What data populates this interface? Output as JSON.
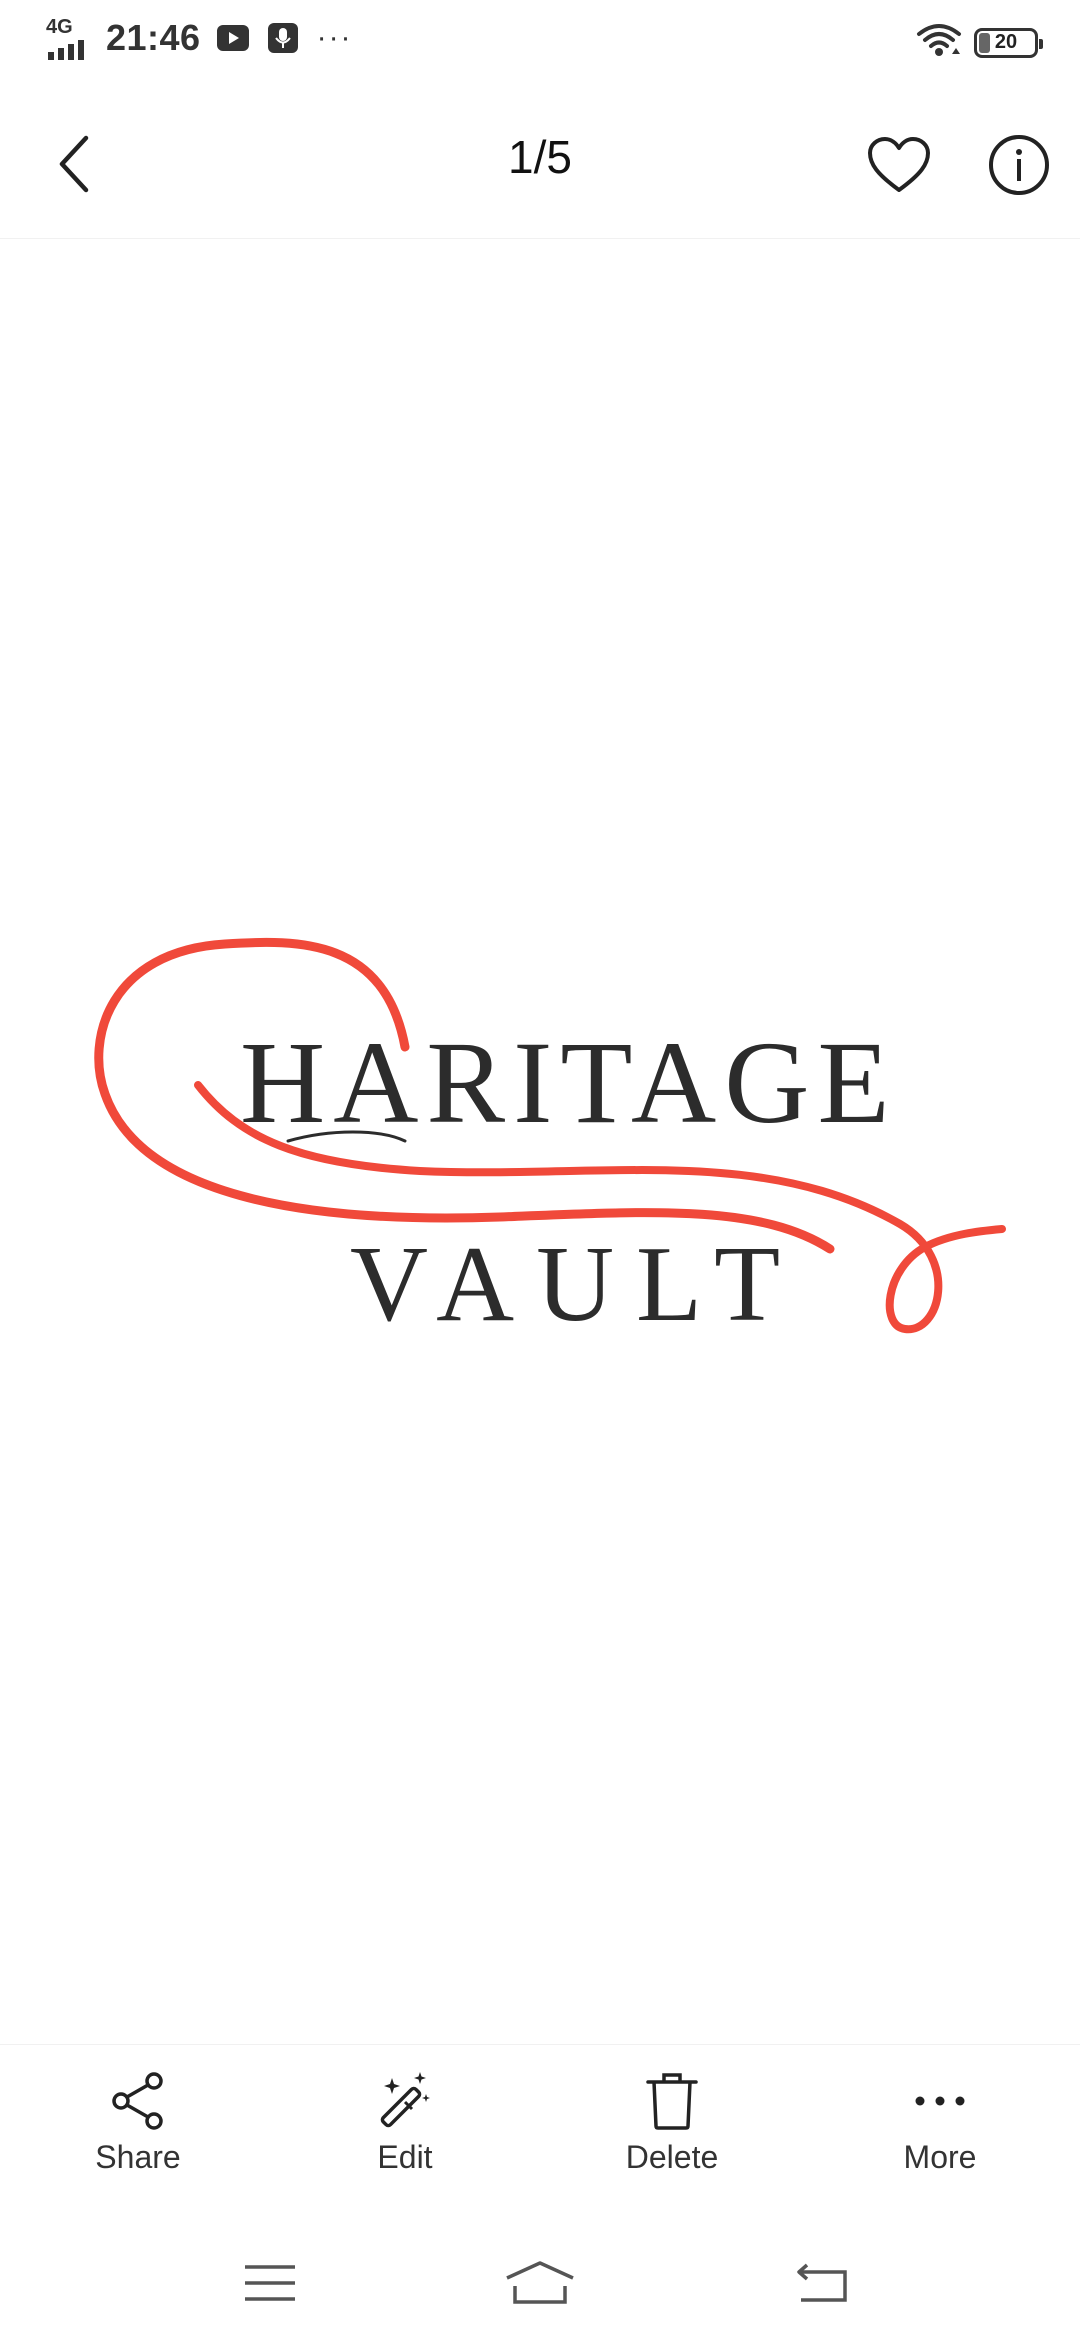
{
  "status_bar": {
    "network_type": "4G",
    "time": "21:46",
    "battery_level": "20",
    "battery_fraction": 0.2,
    "icons": [
      "signal-icon",
      "youtube-icon",
      "voice-recorder-icon",
      "more-dots",
      "wifi-icon",
      "battery-icon"
    ],
    "more_dots": "···"
  },
  "app_bar": {
    "page_counter": "1/5",
    "icons": [
      "back-icon",
      "heart-icon",
      "info-icon"
    ]
  },
  "image": {
    "logo_line1": "HARITAGE",
    "logo_line2": "VAULT",
    "colors": {
      "swash": "#f0493a",
      "text": "#2c2c2c"
    }
  },
  "actions": [
    {
      "label": "Share",
      "icon": "share-icon"
    },
    {
      "label": "Edit",
      "icon": "magic-wand-icon"
    },
    {
      "label": "Delete",
      "icon": "trash-icon"
    },
    {
      "label": "More",
      "icon": "more-icon"
    }
  ],
  "nav_bar": {
    "icons": [
      "menu-icon",
      "home-icon",
      "back-nav-icon"
    ]
  }
}
